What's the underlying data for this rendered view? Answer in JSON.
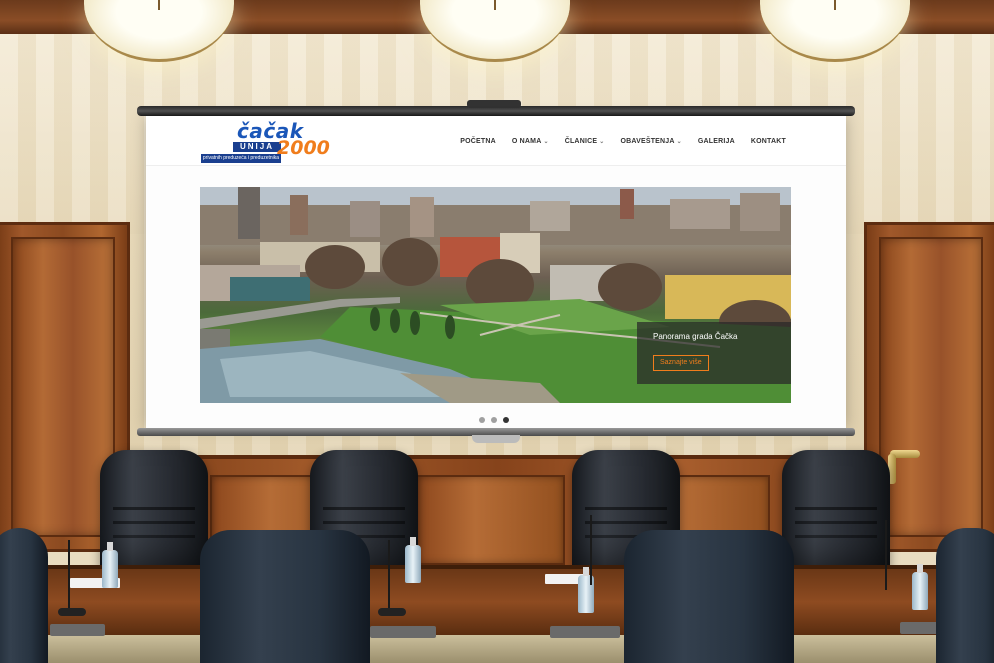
{
  "site": {
    "logo": {
      "top": "čačak",
      "unija": "UNIJA",
      "year": "2000",
      "subtitle": "privatnih preduzeća i preduzetnika"
    },
    "nav": [
      {
        "label": "POČETNA",
        "has_dropdown": false
      },
      {
        "label": "O NAMA",
        "has_dropdown": true
      },
      {
        "label": "ČLANICE",
        "has_dropdown": true
      },
      {
        "label": "OBAVEŠTENJA",
        "has_dropdown": true
      },
      {
        "label": "GALERIJA",
        "has_dropdown": false
      },
      {
        "label": "KONTAKT",
        "has_dropdown": false
      }
    ],
    "dropdown_icon": "chevron-down-icon",
    "slider": {
      "caption_title": "Panorama grada Čačka",
      "button_label": "Saznajte više",
      "slide_count": 3,
      "active_slide": 3
    }
  },
  "colors": {
    "brand_blue": "#1a56b8",
    "brand_orange": "#f07d1c",
    "nav_text": "#333333"
  }
}
